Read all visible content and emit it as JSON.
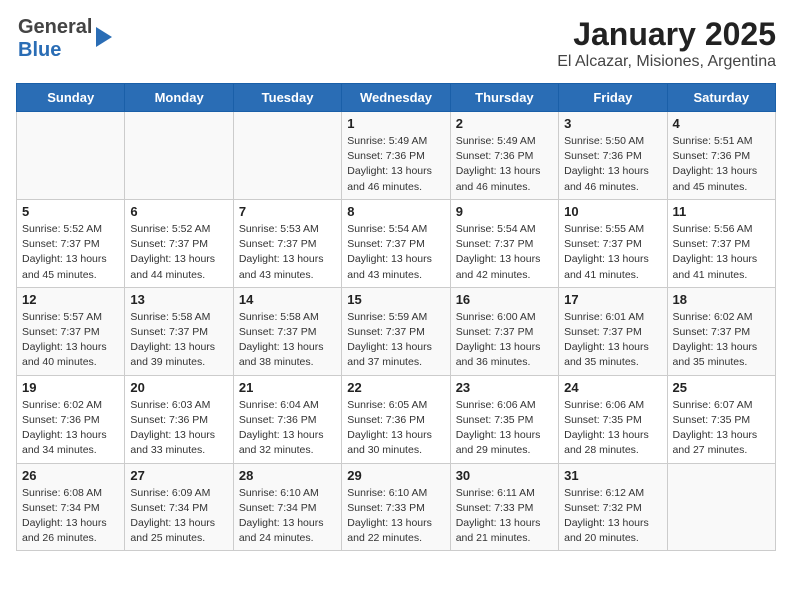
{
  "header": {
    "logo_line1": "General",
    "logo_line2": "Blue",
    "title": "January 2025",
    "subtitle": "El Alcazar, Misiones, Argentina"
  },
  "days_of_week": [
    "Sunday",
    "Monday",
    "Tuesday",
    "Wednesday",
    "Thursday",
    "Friday",
    "Saturday"
  ],
  "weeks": [
    [
      {
        "day": "",
        "info": ""
      },
      {
        "day": "",
        "info": ""
      },
      {
        "day": "",
        "info": ""
      },
      {
        "day": "1",
        "info": "Sunrise: 5:49 AM\nSunset: 7:36 PM\nDaylight: 13 hours\nand 46 minutes."
      },
      {
        "day": "2",
        "info": "Sunrise: 5:49 AM\nSunset: 7:36 PM\nDaylight: 13 hours\nand 46 minutes."
      },
      {
        "day": "3",
        "info": "Sunrise: 5:50 AM\nSunset: 7:36 PM\nDaylight: 13 hours\nand 46 minutes."
      },
      {
        "day": "4",
        "info": "Sunrise: 5:51 AM\nSunset: 7:36 PM\nDaylight: 13 hours\nand 45 minutes."
      }
    ],
    [
      {
        "day": "5",
        "info": "Sunrise: 5:52 AM\nSunset: 7:37 PM\nDaylight: 13 hours\nand 45 minutes."
      },
      {
        "day": "6",
        "info": "Sunrise: 5:52 AM\nSunset: 7:37 PM\nDaylight: 13 hours\nand 44 minutes."
      },
      {
        "day": "7",
        "info": "Sunrise: 5:53 AM\nSunset: 7:37 PM\nDaylight: 13 hours\nand 43 minutes."
      },
      {
        "day": "8",
        "info": "Sunrise: 5:54 AM\nSunset: 7:37 PM\nDaylight: 13 hours\nand 43 minutes."
      },
      {
        "day": "9",
        "info": "Sunrise: 5:54 AM\nSunset: 7:37 PM\nDaylight: 13 hours\nand 42 minutes."
      },
      {
        "day": "10",
        "info": "Sunrise: 5:55 AM\nSunset: 7:37 PM\nDaylight: 13 hours\nand 41 minutes."
      },
      {
        "day": "11",
        "info": "Sunrise: 5:56 AM\nSunset: 7:37 PM\nDaylight: 13 hours\nand 41 minutes."
      }
    ],
    [
      {
        "day": "12",
        "info": "Sunrise: 5:57 AM\nSunset: 7:37 PM\nDaylight: 13 hours\nand 40 minutes."
      },
      {
        "day": "13",
        "info": "Sunrise: 5:58 AM\nSunset: 7:37 PM\nDaylight: 13 hours\nand 39 minutes."
      },
      {
        "day": "14",
        "info": "Sunrise: 5:58 AM\nSunset: 7:37 PM\nDaylight: 13 hours\nand 38 minutes."
      },
      {
        "day": "15",
        "info": "Sunrise: 5:59 AM\nSunset: 7:37 PM\nDaylight: 13 hours\nand 37 minutes."
      },
      {
        "day": "16",
        "info": "Sunrise: 6:00 AM\nSunset: 7:37 PM\nDaylight: 13 hours\nand 36 minutes."
      },
      {
        "day": "17",
        "info": "Sunrise: 6:01 AM\nSunset: 7:37 PM\nDaylight: 13 hours\nand 35 minutes."
      },
      {
        "day": "18",
        "info": "Sunrise: 6:02 AM\nSunset: 7:37 PM\nDaylight: 13 hours\nand 35 minutes."
      }
    ],
    [
      {
        "day": "19",
        "info": "Sunrise: 6:02 AM\nSunset: 7:36 PM\nDaylight: 13 hours\nand 34 minutes."
      },
      {
        "day": "20",
        "info": "Sunrise: 6:03 AM\nSunset: 7:36 PM\nDaylight: 13 hours\nand 33 minutes."
      },
      {
        "day": "21",
        "info": "Sunrise: 6:04 AM\nSunset: 7:36 PM\nDaylight: 13 hours\nand 32 minutes."
      },
      {
        "day": "22",
        "info": "Sunrise: 6:05 AM\nSunset: 7:36 PM\nDaylight: 13 hours\nand 30 minutes."
      },
      {
        "day": "23",
        "info": "Sunrise: 6:06 AM\nSunset: 7:35 PM\nDaylight: 13 hours\nand 29 minutes."
      },
      {
        "day": "24",
        "info": "Sunrise: 6:06 AM\nSunset: 7:35 PM\nDaylight: 13 hours\nand 28 minutes."
      },
      {
        "day": "25",
        "info": "Sunrise: 6:07 AM\nSunset: 7:35 PM\nDaylight: 13 hours\nand 27 minutes."
      }
    ],
    [
      {
        "day": "26",
        "info": "Sunrise: 6:08 AM\nSunset: 7:34 PM\nDaylight: 13 hours\nand 26 minutes."
      },
      {
        "day": "27",
        "info": "Sunrise: 6:09 AM\nSunset: 7:34 PM\nDaylight: 13 hours\nand 25 minutes."
      },
      {
        "day": "28",
        "info": "Sunrise: 6:10 AM\nSunset: 7:34 PM\nDaylight: 13 hours\nand 24 minutes."
      },
      {
        "day": "29",
        "info": "Sunrise: 6:10 AM\nSunset: 7:33 PM\nDaylight: 13 hours\nand 22 minutes."
      },
      {
        "day": "30",
        "info": "Sunrise: 6:11 AM\nSunset: 7:33 PM\nDaylight: 13 hours\nand 21 minutes."
      },
      {
        "day": "31",
        "info": "Sunrise: 6:12 AM\nSunset: 7:32 PM\nDaylight: 13 hours\nand 20 minutes."
      },
      {
        "day": "",
        "info": ""
      }
    ]
  ]
}
